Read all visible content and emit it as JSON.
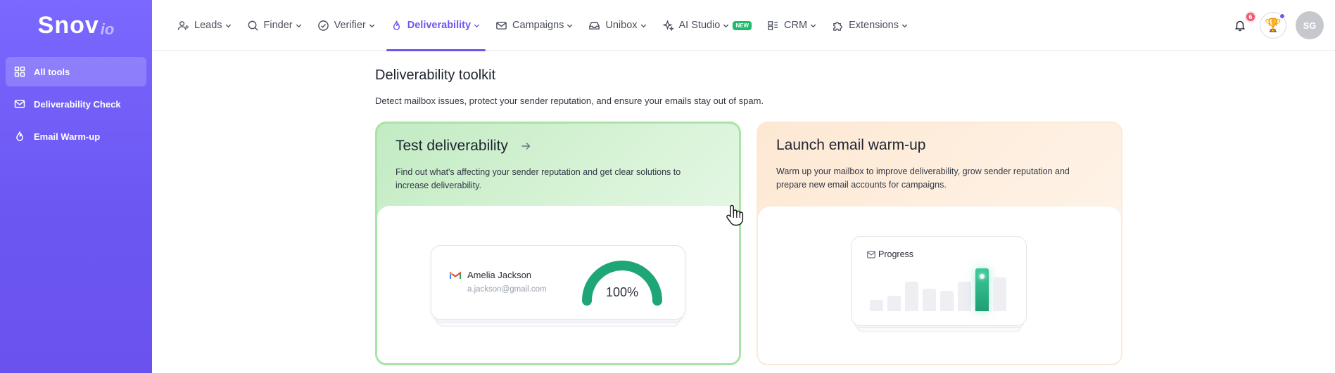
{
  "logo": {
    "main": "Snov",
    "suffix": "io"
  },
  "sidebar": {
    "items": [
      {
        "label": "All tools",
        "icon": "grid-icon",
        "active": true
      },
      {
        "label": "Deliverability Check",
        "icon": "mail-check-icon",
        "active": false
      },
      {
        "label": "Email Warm-up",
        "icon": "flame-icon",
        "active": false
      }
    ]
  },
  "nav": {
    "items": [
      {
        "label": "Leads",
        "icon": "users-icon"
      },
      {
        "label": "Finder",
        "icon": "search-icon"
      },
      {
        "label": "Verifier",
        "icon": "check-circle-icon"
      },
      {
        "label": "Deliverability",
        "icon": "flame-icon",
        "active": true
      },
      {
        "label": "Campaigns",
        "icon": "mail-icon"
      },
      {
        "label": "Unibox",
        "icon": "inbox-icon"
      },
      {
        "label": "AI Studio",
        "icon": "sparkle-icon",
        "badge": "NEW"
      },
      {
        "label": "CRM",
        "icon": "crm-icon"
      },
      {
        "label": "Extensions",
        "icon": "puzzle-icon"
      }
    ]
  },
  "header": {
    "notifications_count": "6",
    "avatar_initials": "SG"
  },
  "main": {
    "title": "Deliverability toolkit",
    "description": "Detect mailbox issues, protect your sender reputation, and ensure your emails stay out of spam."
  },
  "cards": {
    "test": {
      "title": "Test deliverability",
      "text": "Find out what's affecting your sender reputation and get clear solutions to increase deliverability.",
      "mock_name": "Amelia Jackson",
      "mock_email": "a.jackson@gmail.com",
      "gauge_value": "100%",
      "gauge_fraction": 1.0
    },
    "warmup": {
      "title": "Launch email warm-up",
      "text": "Warm up your mailbox to improve deliverability, grow sender reputation and prepare new email accounts for campaigns.",
      "progress_label": "Progress",
      "bar_levels": [
        0.2,
        0.28,
        0.52,
        0.4,
        0.36,
        0.52,
        0.76,
        0.6
      ],
      "highlight_index": 6
    }
  },
  "colors": {
    "accent": "#6c57f2",
    "green": "#1fa676",
    "badge_new": "#1fba6b"
  }
}
